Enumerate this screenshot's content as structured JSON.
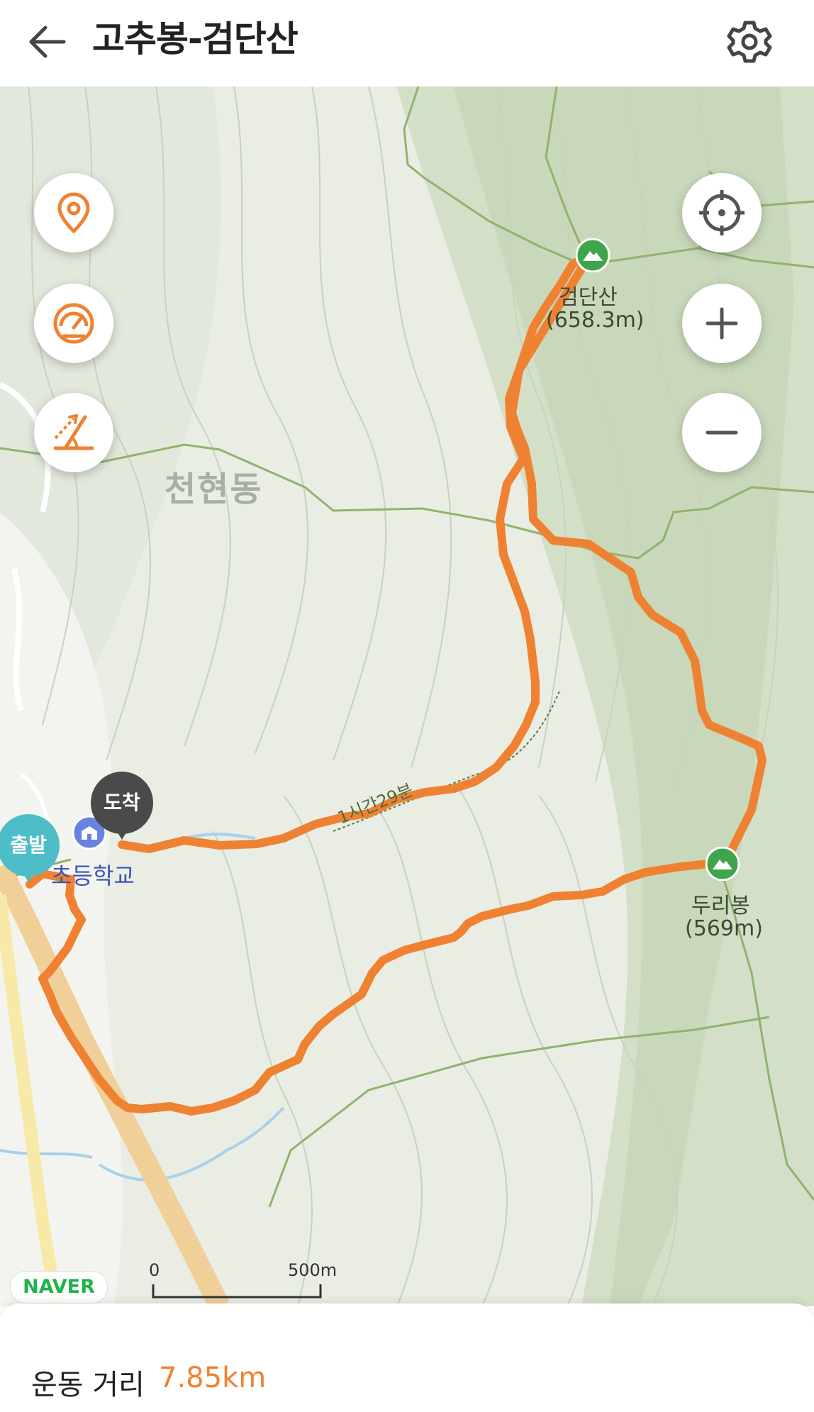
{
  "header": {
    "title": "고추봉-검단산",
    "back_icon": "arrow-left-icon",
    "settings_icon": "gear-icon"
  },
  "map": {
    "area_label": "천현동",
    "peaks": [
      {
        "name": "검단산",
        "elevation": "(658.3m)"
      },
      {
        "name": "두리봉",
        "elevation": "(569m)"
      }
    ],
    "school_label": "초등학교",
    "direction_label": "1시간29분",
    "start_label": "출발",
    "end_label": "도착",
    "brand": "NAVER",
    "scale": {
      "start": "0",
      "end": "500m"
    },
    "controls": {
      "left": [
        "location-pin-icon",
        "speedometer-icon",
        "slope-icon"
      ],
      "right": [
        "crosshair-icon",
        "zoom-in-icon",
        "zoom-out-icon"
      ]
    },
    "colors": {
      "route": "#ef8232",
      "start_pin": "#4fbdc7",
      "end_pin": "#4a4a4a",
      "peak": "#3fa54a",
      "accent": "#ef8232"
    }
  },
  "stats": {
    "label": "운동 거리",
    "value": "7.85km"
  }
}
